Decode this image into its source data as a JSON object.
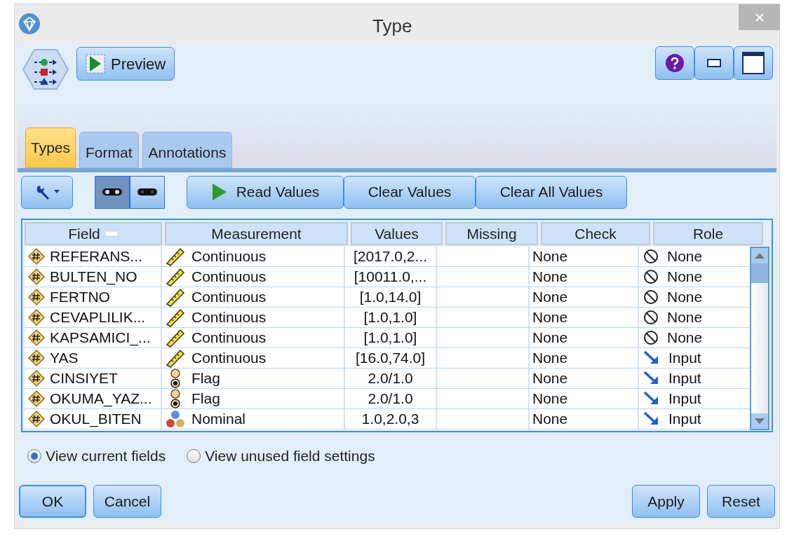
{
  "window": {
    "title": "Type"
  },
  "preview_button": "Preview",
  "tabs": [
    {
      "label": "Types",
      "selected": true
    },
    {
      "label": "Format",
      "selected": false
    },
    {
      "label": "Annotations",
      "selected": false
    }
  ],
  "view_toggle": [
    {
      "selected": true
    },
    {
      "selected": false
    }
  ],
  "actions": [
    "Read Values",
    "Clear Values",
    "Clear All Values"
  ],
  "table": {
    "columns": [
      "Field",
      "Measurement",
      "Values",
      "Missing",
      "Check",
      "Role"
    ],
    "rows": [
      {
        "field": "REFERANS...",
        "measurement": {
          "kind": "continuous",
          "label": "Continuous"
        },
        "values": "[2017.0,2...",
        "check": "None",
        "role": {
          "kind": "none",
          "label": "None"
        }
      },
      {
        "field": "BULTEN_NO",
        "measurement": {
          "kind": "continuous",
          "label": "Continuous"
        },
        "values": "[10011.0,...",
        "check": "None",
        "role": {
          "kind": "none",
          "label": "None"
        }
      },
      {
        "field": "FERTNO",
        "measurement": {
          "kind": "continuous",
          "label": "Continuous"
        },
        "values": "[1.0,14.0]",
        "check": "None",
        "role": {
          "kind": "none",
          "label": "None"
        }
      },
      {
        "field": "CEVAPLILIK...",
        "measurement": {
          "kind": "continuous",
          "label": "Continuous"
        },
        "values": "[1.0,1.0]",
        "check": "None",
        "role": {
          "kind": "none",
          "label": "None"
        }
      },
      {
        "field": "KAPSAMICI_...",
        "measurement": {
          "kind": "continuous",
          "label": "Continuous"
        },
        "values": "[1.0,1.0]",
        "check": "None",
        "role": {
          "kind": "none",
          "label": "None"
        }
      },
      {
        "field": "YAS",
        "measurement": {
          "kind": "continuous",
          "label": "Continuous"
        },
        "values": "[16.0,74.0]",
        "check": "None",
        "role": {
          "kind": "input",
          "label": "Input"
        }
      },
      {
        "field": "CINSIYET",
        "measurement": {
          "kind": "flag",
          "label": "Flag"
        },
        "values": "2.0/1.0",
        "check": "None",
        "role": {
          "kind": "input",
          "label": "Input"
        }
      },
      {
        "field": "OKUMA_YAZ...",
        "measurement": {
          "kind": "flag",
          "label": "Flag"
        },
        "values": "2.0/1.0",
        "check": "None",
        "role": {
          "kind": "input",
          "label": "Input"
        }
      },
      {
        "field": "OKUL_BITEN",
        "measurement": {
          "kind": "nominal",
          "label": "Nominal"
        },
        "values": "1.0,2.0,3",
        "check": "None",
        "role": {
          "kind": "input",
          "label": "Input"
        }
      }
    ]
  },
  "view_options": [
    {
      "label": "View current fields",
      "selected": true
    },
    {
      "label": "View unused field settings",
      "selected": false
    }
  ],
  "buttons_left": [
    {
      "label": "OK",
      "default": true
    },
    {
      "label": "Cancel",
      "default": false
    }
  ],
  "buttons_right": [
    {
      "label": "Apply",
      "default": false
    },
    {
      "label": "Reset",
      "default": false
    }
  ]
}
